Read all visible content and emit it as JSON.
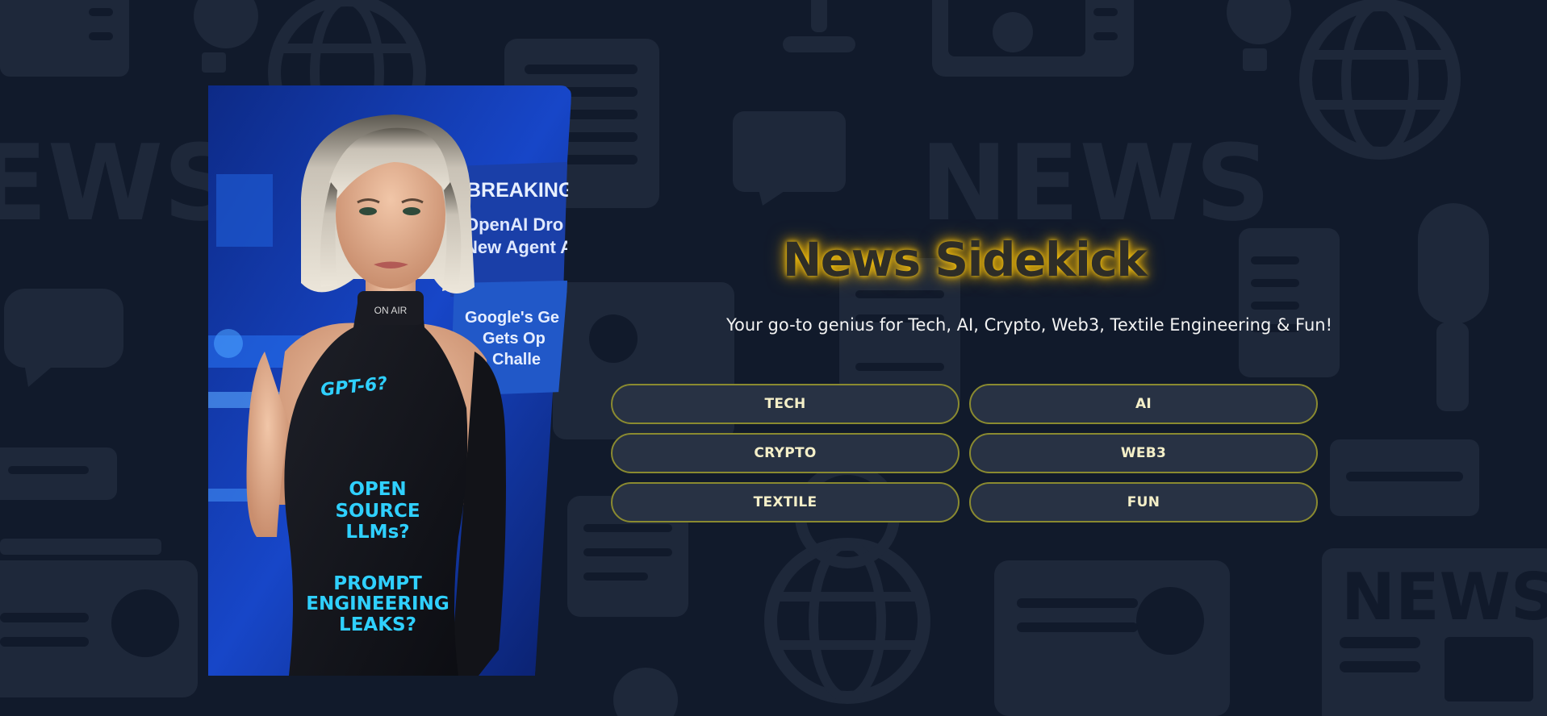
{
  "app": {
    "title": "News Sidekick",
    "subtitle": "Your go-to genius for Tech, AI, Crypto, Web3, Textile Engineering & Fun!"
  },
  "categories": [
    {
      "label": "TECH"
    },
    {
      "label": "AI"
    },
    {
      "label": "CRYPTO"
    },
    {
      "label": "WEB3"
    },
    {
      "label": "TEXTILE"
    },
    {
      "label": "FUN"
    }
  ],
  "background": {
    "words": [
      "NEWS",
      "EWS",
      "NEWS"
    ],
    "icons": [
      "newspaper-icon",
      "tv-icon",
      "globe-icon",
      "microphone-icon",
      "chat-bubble-icon",
      "radio-icon",
      "satellite-dish-icon"
    ]
  },
  "hero": {
    "image": "news-anchor-illustration",
    "screen_headline": "BREAKING",
    "screen_text_1": "OpenAI Dro",
    "screen_text_2": "New Agent A",
    "screen_text_3": "Google's Ge",
    "screen_text_4": "Gets Op",
    "screen_text_5": "Challe",
    "collar_text": "ON AIR",
    "shirt_text_1": "GPT-6?",
    "shirt_text_2": "OPEN SOURCE LLMs?",
    "shirt_text_3": "PROMPT ENGINEERING LEAKS?"
  },
  "colors": {
    "background": "#111a2b",
    "pattern": "#1e283a",
    "accent_glow": "#f0b400",
    "button_border": "#8a8a30",
    "button_fill": "#283244",
    "button_text": "#f4efc8"
  }
}
